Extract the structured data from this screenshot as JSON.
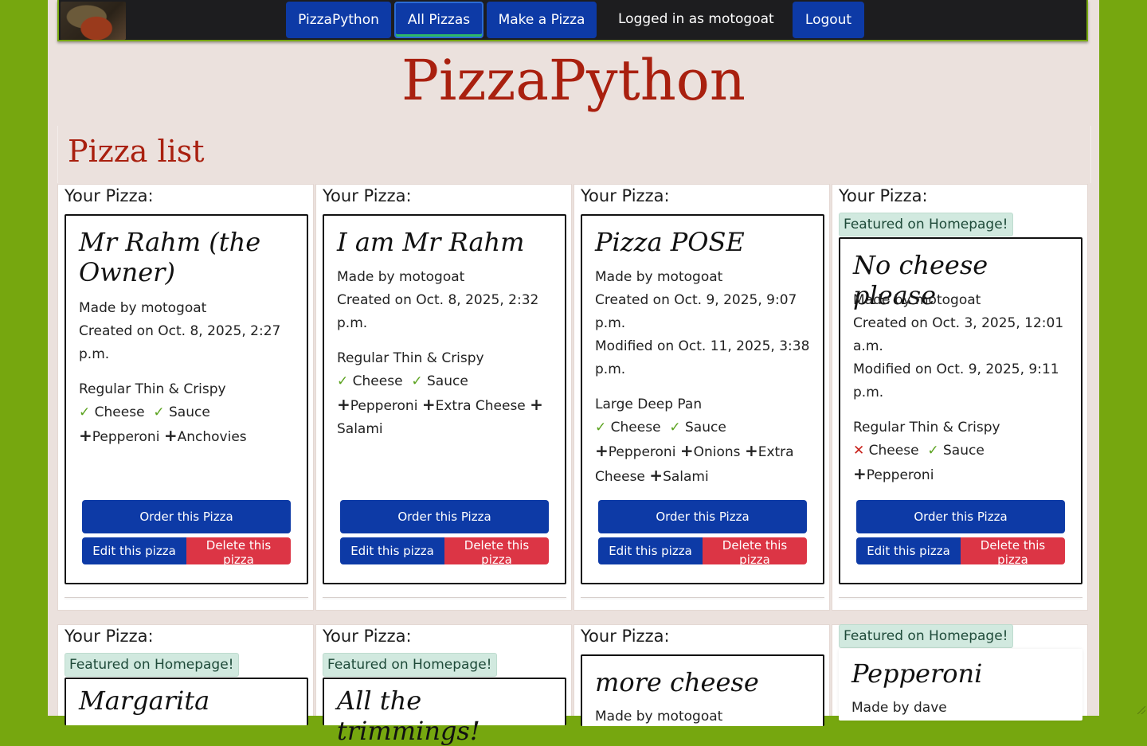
{
  "nav": {
    "brand": "PizzaPython",
    "all_pizzas": "All Pizzas",
    "make_pizza": "Make a Pizza",
    "logged_in": "Logged in as motogoat",
    "logout": "Logout"
  },
  "site_title": "PizzaPython",
  "section_title": "Pizza list",
  "your_pizza_label": "Your Pizza:",
  "featured_label": "Featured on Homepage!",
  "buttons": {
    "order": "Order this Pizza",
    "edit": "Edit this pizza",
    "delete": "Delete this pizza"
  },
  "pizzas": [
    {
      "name": "Mr Rahm (the Owner)",
      "made_by": "Made by motogoat",
      "created": "Created on Oct. 8, 2025, 2:27 p.m.",
      "crust": "Regular Thin & Crispy",
      "cheese": "Cheese",
      "sauce": "Sauce",
      "toppings": [
        "Pepperoni",
        "Anchovies"
      ]
    },
    {
      "name": "I am Mr Rahm",
      "made_by": "Made by motogoat",
      "created": "Created on Oct. 8, 2025, 2:32 p.m.",
      "crust": "Regular Thin & Crispy",
      "cheese": "Cheese",
      "sauce": "Sauce",
      "toppings": [
        "Pepperoni",
        "Extra Cheese",
        "Salami"
      ]
    },
    {
      "name": "Pizza POSE",
      "made_by": "Made by motogoat",
      "created": "Created on Oct. 9, 2025, 9:07 p.m.",
      "modified": "Modified on Oct. 11, 2025, 3:38 p.m.",
      "crust": "Large Deep Pan",
      "cheese": "Cheese",
      "sauce": "Sauce",
      "toppings": [
        "Pepperoni",
        "Onions",
        "Extra Cheese",
        "Salami"
      ]
    },
    {
      "name": "No cheese please",
      "made_by": "Made by motogoat",
      "created": "Created on Oct. 3, 2025, 12:01 a.m.",
      "modified": "Modified on Oct. 9, 2025, 9:11 p.m.",
      "crust": "Regular Thin & Crispy",
      "cheese": "Cheese",
      "sauce": "Sauce",
      "toppings": [
        "Pepperoni"
      ]
    },
    {
      "name": "Margarita"
    },
    {
      "name": "All the trimmings!"
    },
    {
      "name": "more cheese",
      "made_by": "Made by motogoat"
    },
    {
      "name": "Pepperoni",
      "made_by": "Made by dave"
    }
  ],
  "colors": {
    "background": "#76a70f",
    "page": "#ebe1dd",
    "title_red": "#a9200f",
    "primary": "#0d3aa6",
    "danger": "#dc3545",
    "check": "#5aa21e",
    "cross": "#c8211a"
  }
}
